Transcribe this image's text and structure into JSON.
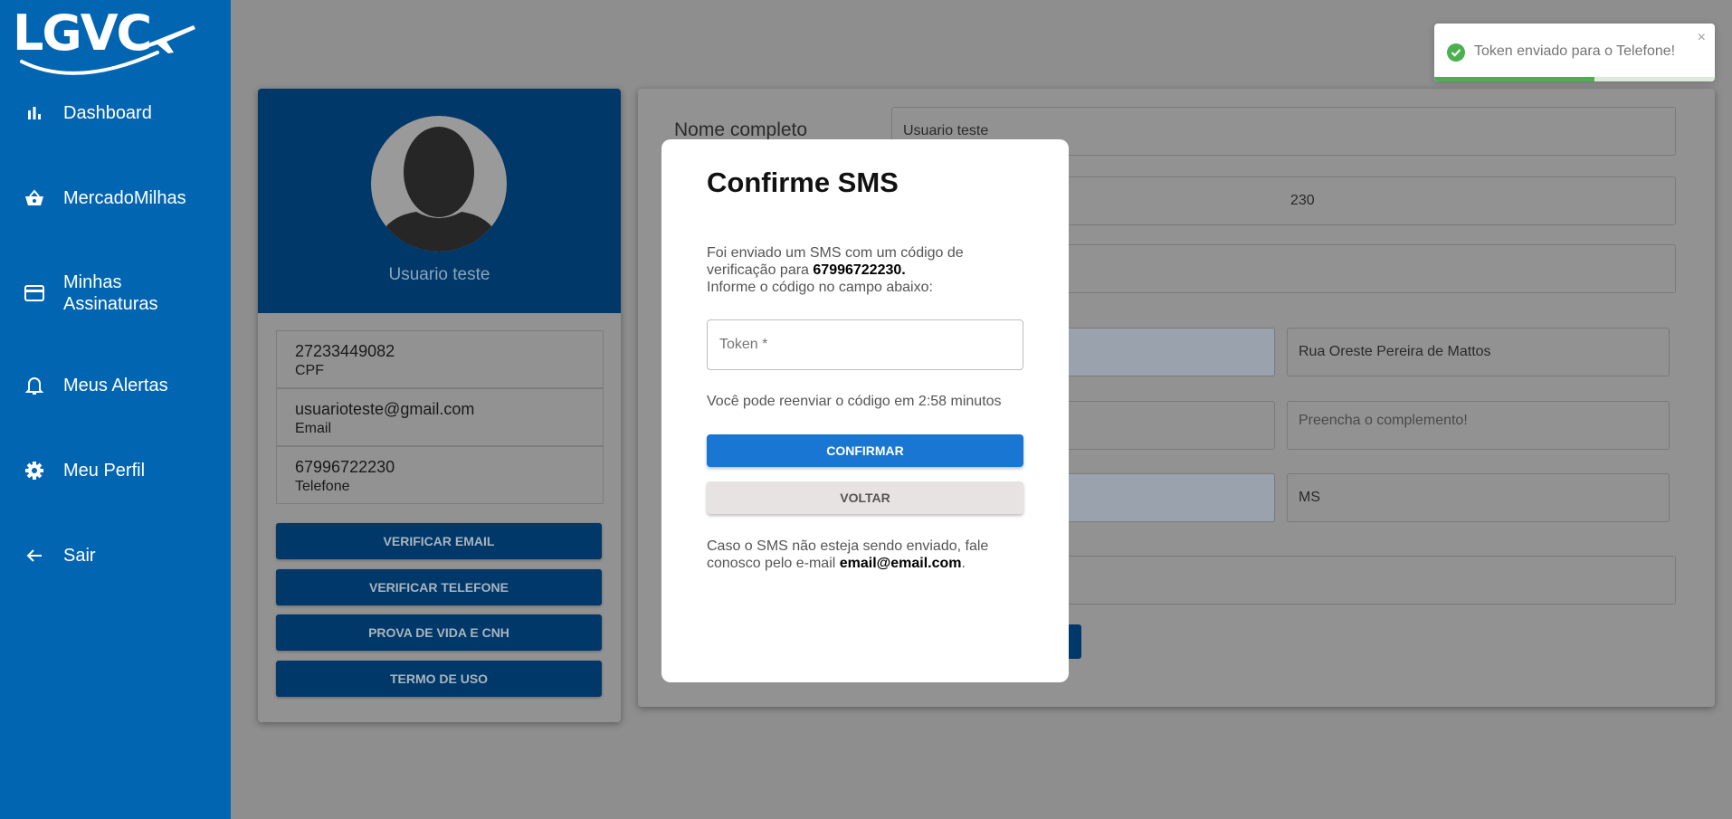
{
  "brand": {
    "name": "LGVC"
  },
  "sidebar": {
    "items": [
      {
        "label": "Dashboard",
        "icon": "bar-chart-icon"
      },
      {
        "label": "MercadoMilhas",
        "icon": "basket-icon"
      },
      {
        "label": "Minhas Assinaturas",
        "icon": "credit-card-icon"
      },
      {
        "label": "Meus Alertas",
        "icon": "bell-icon"
      },
      {
        "label": "Meu Perfil",
        "icon": "gear-icon"
      },
      {
        "label": "Sair",
        "icon": "arrow-left-icon"
      }
    ]
  },
  "profile": {
    "name": "Usuario teste",
    "cpf_value": "27233449082",
    "cpf_label": "CPF",
    "email_value": "usuarioteste@gmail.com",
    "email_label": "Email",
    "phone_value": "67996722230",
    "phone_label": "Telefone",
    "buttons": [
      "VERIFICAR EMAIL",
      "VERIFICAR TELEFONE",
      "PROVA DE VIDA E CNH",
      "TERMO DE USO"
    ]
  },
  "form": {
    "label_full_name": "Nome completo",
    "full_name": "Usuario teste",
    "phone_partial": "230",
    "street": "Rua Oreste Pereira de Mattos",
    "complement_placeholder": "Preencha o complemento!",
    "state": "MS"
  },
  "modal": {
    "title": "Confirme SMS",
    "desc_before": "Foi enviado um SMS com um código de verificação para ",
    "desc_phone": "67996722230.",
    "desc_after": "Informe o código no campo abaixo:",
    "token_placeholder": "Token *",
    "resend_text": "Você pode reenviar o código em 2:58 minutos",
    "confirm_label": "CONFIRMAR",
    "back_label": "VOLTAR",
    "footer_before": "Caso o SMS não esteja sendo enviado, fale conosco pelo e-mail ",
    "footer_email": "email@email.com",
    "footer_after": "."
  },
  "toast": {
    "message": "Token enviado para o Telefone!",
    "close": "×",
    "progress": 0.57,
    "status_color": "#4caf50"
  },
  "colors": {
    "sidebar": "#0265b2",
    "primary_button": "#1976d2",
    "profile_header": "#003869"
  }
}
